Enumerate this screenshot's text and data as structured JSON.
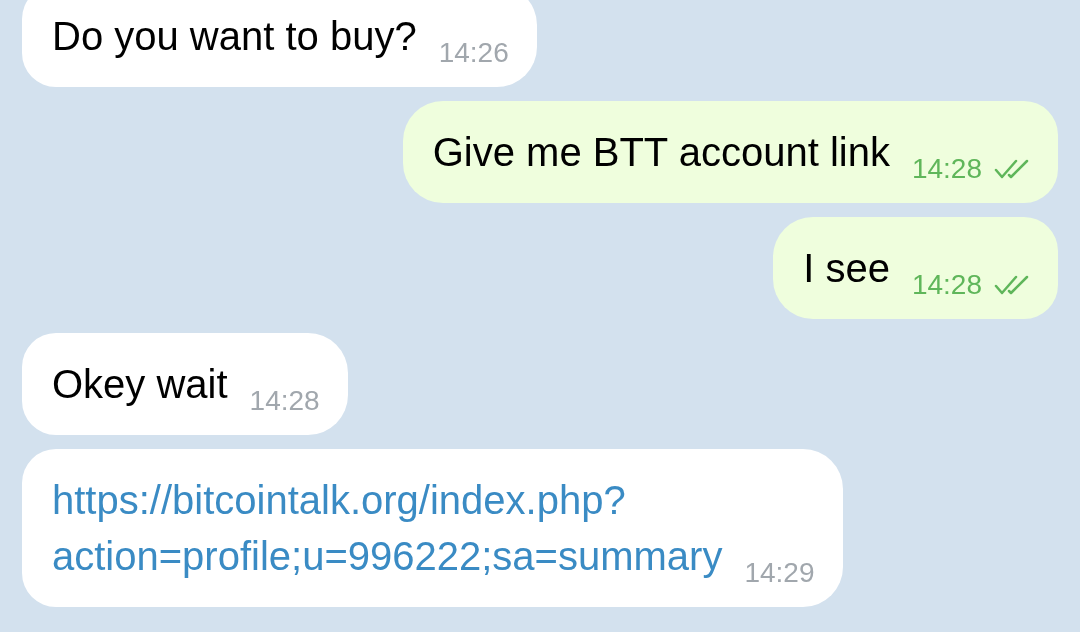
{
  "messages": [
    {
      "outgoing": false,
      "kind": "text",
      "text": "Do you want to buy?",
      "time": "14:26",
      "read": false
    },
    {
      "outgoing": true,
      "kind": "text",
      "text": "Give me BTT account link",
      "time": "14:28",
      "read": true
    },
    {
      "outgoing": true,
      "kind": "text",
      "text": "I see",
      "time": "14:28",
      "read": true
    },
    {
      "outgoing": false,
      "kind": "text",
      "text": "Okey wait",
      "time": "14:28",
      "read": false
    },
    {
      "outgoing": false,
      "kind": "link",
      "lines": [
        "https://bitcointalk.org/index.php?",
        "action=profile;u=996222;sa=summary"
      ],
      "time": "14:29",
      "read": false
    }
  ]
}
